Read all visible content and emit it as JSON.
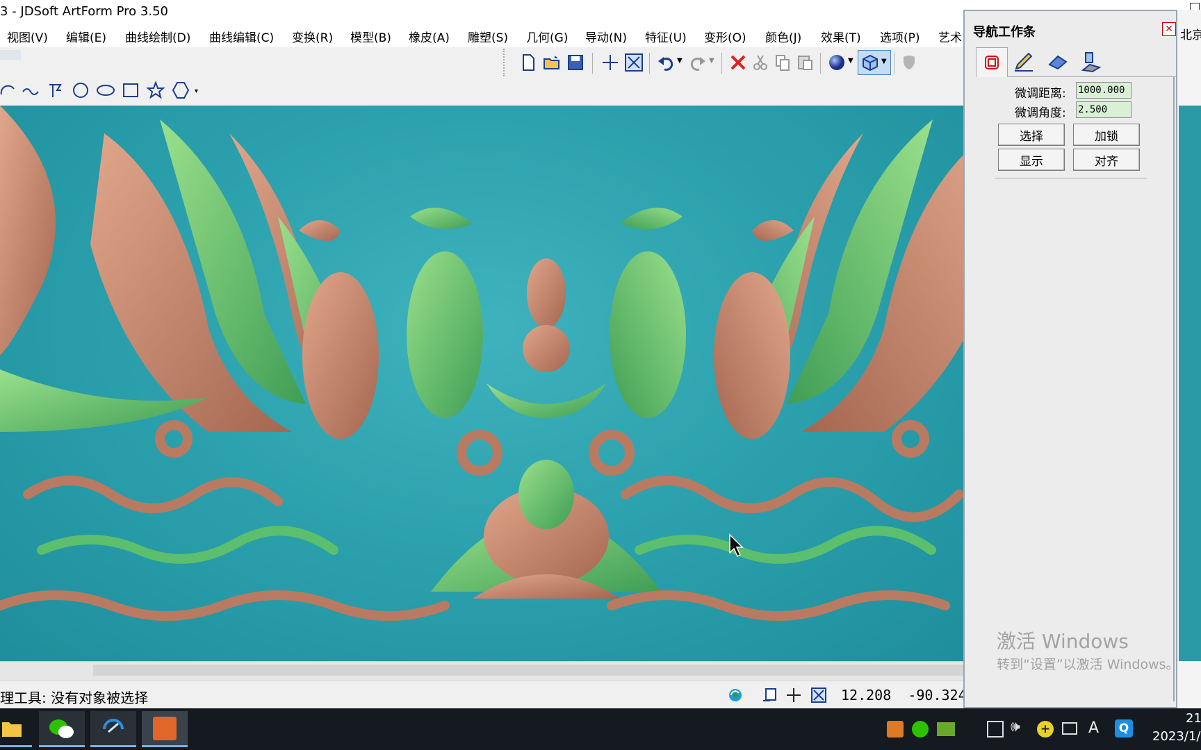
{
  "window": {
    "title": "3 - JDSoft ArtForm Pro 3.50"
  },
  "menu": [
    {
      "label": "视图(V)"
    },
    {
      "label": "编辑(E)"
    },
    {
      "label": "曲线绘制(D)"
    },
    {
      "label": "曲线编辑(C)"
    },
    {
      "label": "变换(R)"
    },
    {
      "label": "模型(B)"
    },
    {
      "label": "橡皮(A)"
    },
    {
      "label": "雕塑(S)"
    },
    {
      "label": "几何(G)"
    },
    {
      "label": "导动(N)"
    },
    {
      "label": "特征(U)"
    },
    {
      "label": "变形(O)"
    },
    {
      "label": "颜色(J)"
    },
    {
      "label": "效果(T)"
    },
    {
      "label": "选项(P)"
    },
    {
      "label": "艺术"
    }
  ],
  "menu_right_fragment": "北京",
  "toolbar_icons": [
    "new-file-icon",
    "open-folder-icon",
    "save-icon",
    "crosshair-icon",
    "fit-view-icon",
    "undo-icon",
    "redo-icon",
    "delete-icon",
    "cut-icon",
    "copy-icon",
    "paste-icon",
    "render-sphere-icon",
    "view-cube-icon",
    "shield-icon"
  ],
  "draw_tools": [
    "arc-icon",
    "spline-icon",
    "polyline-icon",
    "circle-icon",
    "ellipse-icon",
    "rectangle-icon",
    "star-icon",
    "polygon-icon"
  ],
  "status": {
    "message": "理工具: 没有对象被选择",
    "coords": "12.208  -90.324"
  },
  "nav_panel": {
    "title": "导航工作条",
    "tabs": [
      "select-tab-icon",
      "edit-tab-icon",
      "surface-tab-icon",
      "tool-tab-icon"
    ],
    "fine_distance_label": "微调距离:",
    "fine_distance_value": "1000.000",
    "fine_angle_label": "微调角度:",
    "fine_angle_value": "2.500",
    "buttons": {
      "select": "选择",
      "lock": "加锁",
      "show": "显示",
      "align": "对齐"
    },
    "watermark_line1": "激活 Windows",
    "watermark_line2": "转到“设置”以激活 Windows。"
  },
  "taskbar": {
    "clock_time": "21",
    "clock_date": "2023/1/",
    "tray_letter": "A"
  },
  "colors": {
    "viewport_bg": "#2ca2ae",
    "relief_green": "#5ec46a",
    "relief_copper": "#c9866a"
  }
}
